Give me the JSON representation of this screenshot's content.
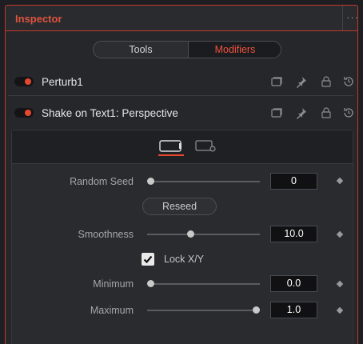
{
  "panel": {
    "title": "Inspector",
    "more_label": "···"
  },
  "tabs": {
    "tools": "Tools",
    "modifiers": "Modifiers",
    "active": "Modifiers"
  },
  "modifiers": [
    {
      "label": "Perturb1",
      "enabled": true
    },
    {
      "label": "Shake on Text1: Perspective",
      "enabled": true
    }
  ],
  "row_icons": [
    "collapse-icon",
    "pin-icon",
    "lock-icon",
    "reset-icon"
  ],
  "sub_tabs": [
    "controls-tab-icon",
    "settings-tab-icon"
  ],
  "controls": {
    "random_seed": {
      "label": "Random Seed",
      "value": "0",
      "fraction": 0.0
    },
    "reseed_label": "Reseed",
    "smoothness": {
      "label": "Smoothness",
      "value": "10.0",
      "fraction": 0.38
    },
    "lock_xy": {
      "label": "Lock X/Y",
      "checked": true
    },
    "minimum": {
      "label": "Minimum",
      "value": "0.0",
      "fraction": 0.0
    },
    "maximum": {
      "label": "Maximum",
      "value": "1.0",
      "fraction": 1.0
    }
  },
  "colors": {
    "accent": "#e8472f",
    "border_active": "#c0392b"
  }
}
